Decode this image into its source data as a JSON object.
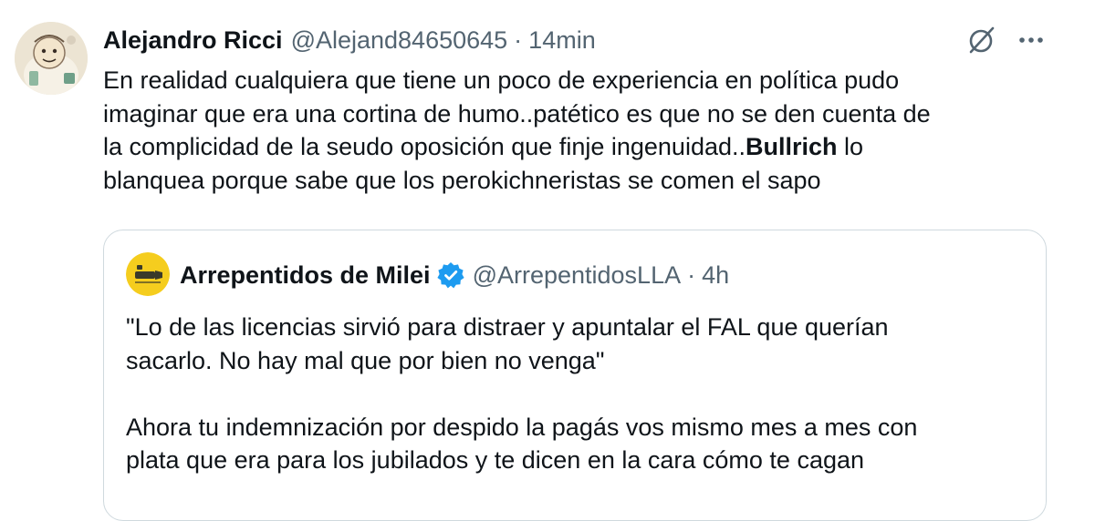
{
  "tweet": {
    "author_name": "Alejandro Ricci",
    "author_handle": "@Alejand84650645",
    "separator": "·",
    "time": "14min",
    "icons": {
      "avatar": "cartoon-avatar",
      "grok": "grok-icon",
      "more": "more-icon"
    },
    "lines": {
      "l1": "En realidad cualquiera que tiene un poco de experiencia en política pudo",
      "l2": "imaginar que era una cortina de humo..patético es que no se den cuenta de",
      "l3_pre": "la complicidad de la seudo oposición que finje ingenuidad..",
      "l3_bold": "Bullrich",
      "l3_post": " lo",
      "l4": "blanquea porque sabe que los perokichneristas se comen el sapo"
    }
  },
  "quoted": {
    "author_name": "Arrepentidos de Milei",
    "verified": "verified-badge-icon",
    "author_handle": "@ArrepentidosLLA",
    "separator": "·",
    "time": "4h",
    "lines": {
      "p1_l1": "\"Lo de las licencias sirvió para distraer y apuntalar el FAL que querían",
      "p1_l2": "sacarlo. No hay mal que por bien no venga\"",
      "p2_l1": "Ahora tu indemnización por despido la pagás vos mismo mes a mes con",
      "p2_l2": "plata que era para los jubilados y te dicen en la cara cómo te cagan"
    }
  },
  "colors": {
    "text": "#0f1419",
    "secondary": "#536471",
    "border": "#cfd9de",
    "verified": "#1d9bf0",
    "quoted_avatar": "#f5cd1e"
  }
}
